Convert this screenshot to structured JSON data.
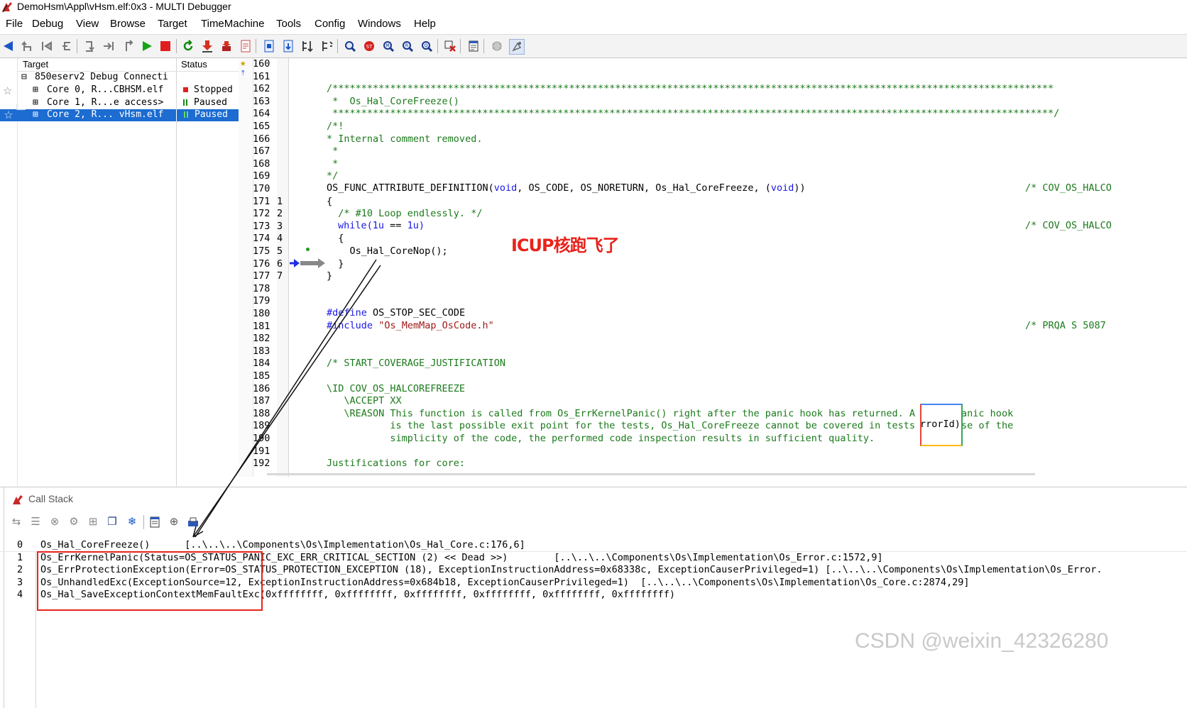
{
  "window": {
    "title": "DemoHsm\\Appl\\vHsm.elf:0x3 - MULTI Debugger"
  },
  "menu": [
    "File",
    "Debug",
    "View",
    "Browse",
    "Target",
    "TimeMachine",
    "Tools",
    "Config",
    "Windows",
    "Help"
  ],
  "target_pane": {
    "headers": {
      "target": "Target",
      "status": "Status"
    },
    "rows": [
      {
        "toggle": "⊟",
        "label": "850eserv2 Debug Connecti",
        "status": "",
        "status_icon": ""
      },
      {
        "toggle": "⊞",
        "label": "Core 0, R...CBHSM.elf",
        "status": "Stopped",
        "status_icon": "stop-square",
        "status_color": "#e02020"
      },
      {
        "toggle": "⊞",
        "label": "Core 1, R...e access>",
        "status": "Paused",
        "status_icon": "pause-bars",
        "status_color": "#138a13"
      },
      {
        "toggle": "⊞",
        "label": "Core 2, R... vHsm.elf",
        "status": "Paused",
        "status_icon": "pause-bars",
        "status_color": "#138a13",
        "selected": true
      }
    ]
  },
  "source": {
    "lines": [
      {
        "n": "160",
        "m": "",
        "code": ""
      },
      {
        "n": "161",
        "m": "",
        "code": ""
      },
      {
        "n": "162",
        "m": "",
        "code": "/*****************************************************************************************************************************",
        "cls": "cm"
      },
      {
        "n": "163",
        "m": "",
        "code": " *  Os_Hal_CoreFreeze()",
        "cls": "cm"
      },
      {
        "n": "164",
        "m": "",
        "code": " *****************************************************************************************************************************/",
        "cls": "cm"
      },
      {
        "n": "165",
        "m": "",
        "code": "/*!",
        "cls": "cm"
      },
      {
        "n": "166",
        "m": "",
        "code": "* Internal comment removed.",
        "cls": "cm"
      },
      {
        "n": "167",
        "m": "",
        "code": " *",
        "cls": "cm"
      },
      {
        "n": "168",
        "m": "",
        "code": " *",
        "cls": "cm"
      },
      {
        "n": "169",
        "m": "",
        "code": "*/",
        "cls": "cm"
      },
      {
        "n": "170",
        "m": "",
        "code": ""
      },
      {
        "n": "171",
        "m": "1",
        "code": "{"
      },
      {
        "n": "172",
        "m": "2",
        "code": "  /* #10 Loop endlessly. */",
        "cls": "cm"
      },
      {
        "n": "173",
        "m": "3",
        "code": ""
      },
      {
        "n": "174",
        "m": "4",
        "code": "  {"
      },
      {
        "n": "175",
        "m": "5",
        "code": "    Os_Hal_CoreNop();"
      },
      {
        "n": "176",
        "m": "6",
        "code": "  }"
      },
      {
        "n": "177",
        "m": "7",
        "code": "}"
      },
      {
        "n": "178",
        "m": "",
        "code": ""
      },
      {
        "n": "179",
        "m": "",
        "code": ""
      },
      {
        "n": "180",
        "m": "",
        "code": ""
      },
      {
        "n": "181",
        "m": "",
        "code": ""
      },
      {
        "n": "182",
        "m": "",
        "code": ""
      },
      {
        "n": "183",
        "m": "",
        "code": ""
      },
      {
        "n": "184",
        "m": "",
        "code": "/* START_COVERAGE_JUSTIFICATION",
        "cls": "cm"
      },
      {
        "n": "185",
        "m": "",
        "code": ""
      },
      {
        "n": "186",
        "m": "",
        "code": "\\ID COV_OS_HALCOREFREEZE",
        "cls": "cm"
      },
      {
        "n": "187",
        "m": "",
        "code": "   \\ACCEPT XX",
        "cls": "cm"
      },
      {
        "n": "188",
        "m": "",
        "code": "   \\REASON This function is called from Os_ErrKernelPanic() right after the panic hook has returned. A        anic hook",
        "cls": "cm"
      },
      {
        "n": "189",
        "m": "",
        "code": "           is the last possible exit point for the tests, Os_Hal_CoreFreeze cannot be covered in tests        se of the",
        "cls": "cm"
      },
      {
        "n": "190",
        "m": "",
        "code": "           simplicity of the code, the performed code inspection results in sufficient quality.",
        "cls": "cm"
      },
      {
        "n": "191",
        "m": "",
        "code": ""
      },
      {
        "n": "192",
        "m": "",
        "code": "Justifications for core:",
        "cls": "cm"
      }
    ],
    "line170": {
      "fn": "OS_FUNC_ATTRIBUTE_DEFINITION(",
      "kw1": "void",
      "mid": ", OS_CODE, OS_NORETURN, Os_Hal_CoreFreeze, (",
      "kw2": "void",
      "end": "))"
    },
    "line173": {
      "kw": "while",
      "p1": "(",
      "a": "1u",
      "op": " == ",
      "b": "1u",
      "p2": ")"
    },
    "line180": {
      "hash": "#de",
      "kwtail": "fine",
      "rest": " OS_STOP_SEC_CODE"
    },
    "line181": {
      "hash": "#i",
      "kwtail": "nclude",
      "sp": " ",
      "str": "\"Os_MemMap_OsCode.h\""
    },
    "cov_comments": [
      {
        "line": "170",
        "text": "/* COV_OS_HALCO"
      },
      {
        "line": "173",
        "text": "/* COV_OS_HALCO"
      },
      {
        "line": "181",
        "text": "/* PRQA S 5087"
      }
    ],
    "popup_text": "rrorId)",
    "annotation": "ICUP核跑飞了",
    "annotation_color": "#e8231c"
  },
  "callstack": {
    "title": "Call Stack",
    "rows": [
      {
        "idx": "0",
        "text": "Os_Hal_CoreFreeze()      [..\\..\\..\\Components\\Os\\Implementation\\Os_Hal_Core.c:176,6]"
      },
      {
        "idx": "1",
        "text": "Os_ErrKernelPanic(Status=OS_STATUS_PANIC_EXC_ERR_CRITICAL_SECTION (2) << Dead >>)        [..\\..\\..\\Components\\Os\\Implementation\\Os_Error.c:1572,9]"
      },
      {
        "idx": "2",
        "text": "Os_ErrProtectionException(Error=OS_STATUS_PROTECTION_EXCEPTION (18), ExceptionInstructionAddress=0x68338c, ExceptionCauserPrivileged=1) [..\\..\\..\\Components\\Os\\Implementation\\Os_Error."
      },
      {
        "idx": "3",
        "text": "Os_UnhandledExc(ExceptionSource=12, ExceptionInstructionAddress=0x684b18, ExceptionCauserPrivileged=1)  [..\\..\\..\\Components\\Os\\Implementation\\Os_Core.c:2874,29]"
      },
      {
        "idx": "4",
        "text": "Os_Hal_SaveExceptionContextMemFaultExc(0xffffffff, 0xffffffff, 0xffffffff, 0xffffffff, 0xffffffff, 0xffffffff)"
      }
    ]
  },
  "watermark": "CSDN @weixin_42326280",
  "colors": {
    "selection": "#1c6cd1",
    "highlight_box": "#e8231c",
    "comment": "#1b7a1b",
    "keyword": "#1a18e6",
    "string": "#a01a1a"
  },
  "icons": [
    "back-arrow-icon",
    "up-stack-icon",
    "run-icon",
    "halt-icon",
    "restart-icon",
    "download-icon",
    "breakpoint-icon",
    "zoom-icon",
    "watch-icon"
  ]
}
